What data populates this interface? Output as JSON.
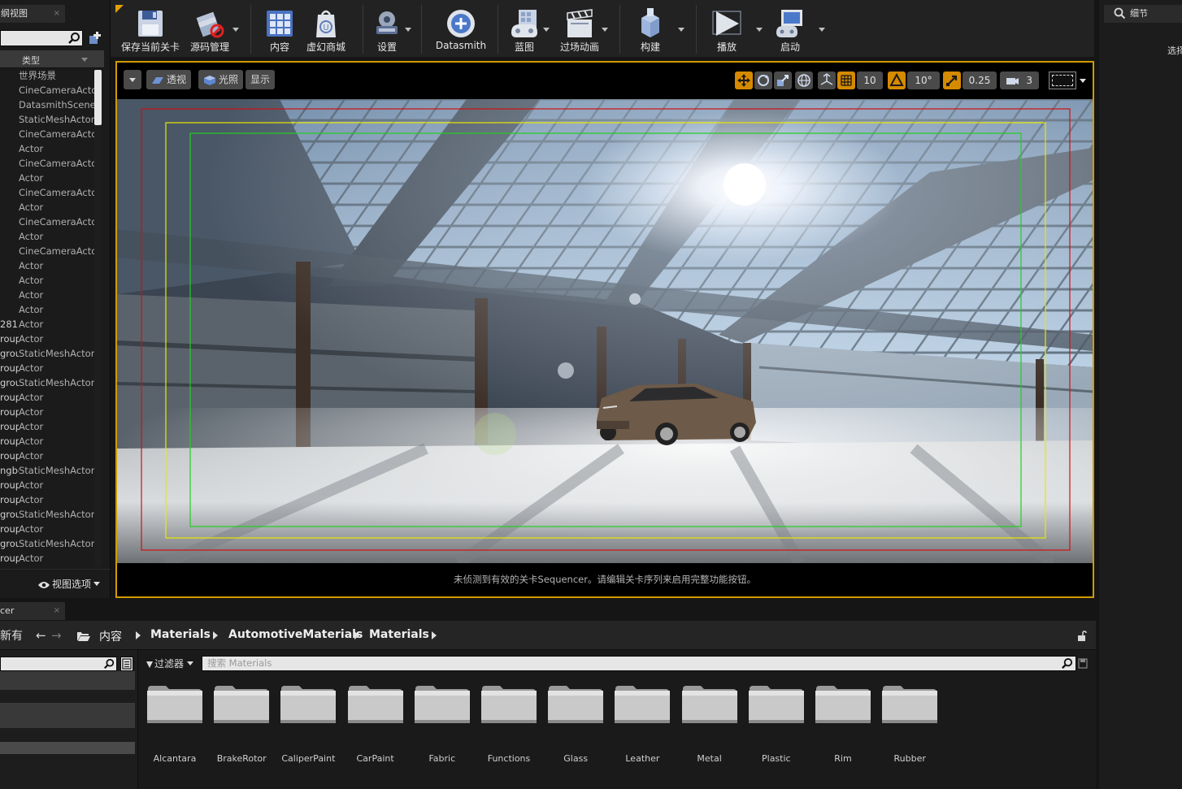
{
  "outliner": {
    "tab_title": "纲视图",
    "close": "×",
    "column_type": "类型",
    "rows": [
      {
        "name": "",
        "type": "世界场景"
      },
      {
        "name": "",
        "type": "CineCameraActo"
      },
      {
        "name": "",
        "type": "DatasmithScene"
      },
      {
        "name": "",
        "type": "StaticMeshActor"
      },
      {
        "name": "",
        "type": "CineCameraActo"
      },
      {
        "name": "",
        "type": "Actor"
      },
      {
        "name": "",
        "type": "CineCameraActo"
      },
      {
        "name": "",
        "type": "Actor"
      },
      {
        "name": "",
        "type": "CineCameraActo"
      },
      {
        "name": "",
        "type": "Actor"
      },
      {
        "name": "",
        "type": "CineCameraActo"
      },
      {
        "name": "",
        "type": "Actor"
      },
      {
        "name": "",
        "type": "CineCameraActo"
      },
      {
        "name": "",
        "type": "Actor"
      },
      {
        "name": "",
        "type": "Actor"
      },
      {
        "name": "",
        "type": "Actor"
      },
      {
        "name": "",
        "type": "Actor"
      },
      {
        "name": "281",
        "type": "Actor"
      },
      {
        "name": "roup",
        "type": "Actor"
      },
      {
        "name": "grou",
        "type": "StaticMeshActor"
      },
      {
        "name": "roup",
        "type": "Actor"
      },
      {
        "name": "grou",
        "type": "StaticMeshActor"
      },
      {
        "name": "roup",
        "type": "Actor"
      },
      {
        "name": "roup",
        "type": "Actor"
      },
      {
        "name": "roup",
        "type": "Actor"
      },
      {
        "name": "roup",
        "type": "Actor"
      },
      {
        "name": "roup",
        "type": "Actor"
      },
      {
        "name": "ngbo",
        "type": "StaticMeshActor"
      },
      {
        "name": "roup",
        "type": "Actor"
      },
      {
        "name": "roup",
        "type": "Actor"
      },
      {
        "name": "grou",
        "type": "StaticMeshActor"
      },
      {
        "name": "roup",
        "type": "Actor"
      },
      {
        "name": "grou",
        "type": "StaticMeshActor"
      },
      {
        "name": "roup",
        "type": "Actor"
      }
    ],
    "view_options": "视图选项"
  },
  "toolbar": {
    "buttons": [
      {
        "label": "保存当前关卡",
        "icon": "save-icon"
      },
      {
        "label": "源码管理",
        "icon": "source-control-icon"
      },
      {
        "label": "内容",
        "icon": "content-icon"
      },
      {
        "label": "虚幻商城",
        "icon": "marketplace-icon"
      },
      {
        "label": "设置",
        "icon": "settings-icon"
      },
      {
        "label": "Datasmith",
        "icon": "datasmith-icon"
      },
      {
        "label": "蓝图",
        "icon": "blueprint-icon"
      },
      {
        "label": "过场动画",
        "icon": "cinematics-icon"
      },
      {
        "label": "构建",
        "icon": "build-icon"
      },
      {
        "label": "播放",
        "icon": "play-icon"
      },
      {
        "label": "启动",
        "icon": "launch-icon"
      }
    ]
  },
  "details": {
    "tab_title": "细节",
    "hint": "选择"
  },
  "viewport": {
    "perspective": "透视",
    "lit": "光照",
    "show": "显示",
    "grid_snap": "10",
    "rotation_snap": "10°",
    "scale_snap": "0.25",
    "camera_speed": "3",
    "message": "未侦测到有效的关卡Sequencer。请编辑关卡序列来启用完整功能按钮。"
  },
  "content_browser": {
    "tab_title": "cer",
    "close": "×",
    "add_label": "新有",
    "breadcrumb": [
      "内容",
      "Materials",
      "AutomotiveMaterials",
      "Materials"
    ],
    "filters_label": "过滤器",
    "search_placeholder": "搜索 Materials",
    "folders": [
      "Alcantara",
      "BrakeRotor",
      "CaliperPaint",
      "CarPaint",
      "Fabric",
      "Functions",
      "Glass",
      "Leather",
      "Metal",
      "Plastic",
      "Rim",
      "Rubber"
    ]
  },
  "colors": {
    "accent": "#d68a00",
    "viewport_border": "#d19b00",
    "safe_frame_red": "#d01010",
    "safe_frame_yellow": "#e8e800",
    "safe_frame_green": "#20d020"
  }
}
